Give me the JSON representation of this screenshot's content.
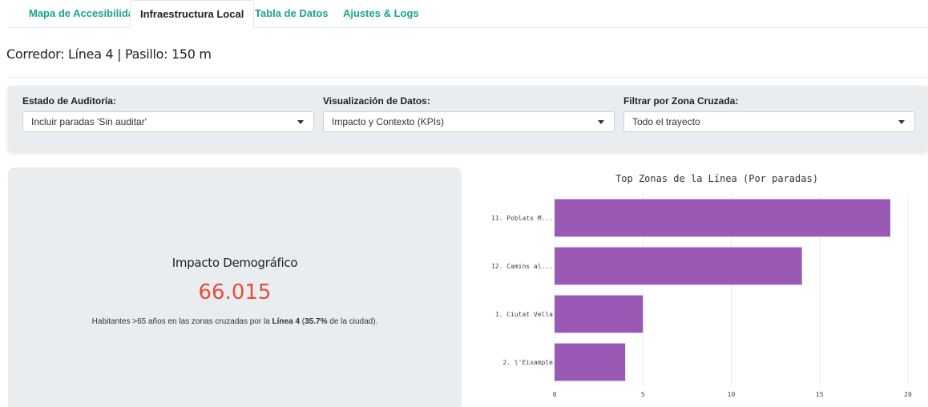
{
  "tabs": [
    {
      "label": "Mapa de Accesibilidad",
      "active": false
    },
    {
      "label": "Infraestructura Local",
      "active": true
    },
    {
      "label": "Tabla de Datos",
      "active": false
    },
    {
      "label": "Ajustes & Logs",
      "active": false
    }
  ],
  "header": {
    "title": "Corredor: Línea 4 | Pasillo: 150 m"
  },
  "filters": {
    "audit": {
      "label": "Estado de Auditoría:",
      "value": "Incluir paradas 'Sin auditar'"
    },
    "viz": {
      "label": "Visualización de Datos:",
      "value": "Impacto y Contexto (KPIs)"
    },
    "zone": {
      "label": "Filtrar por Zona Cruzada:",
      "value": "Todo el trayecto"
    }
  },
  "kpi": {
    "title": "Impacto Demográfico",
    "value": "66.015",
    "desc_prefix": "Habitantes >65 años en las zonas cruzadas por la ",
    "desc_line": "Línea 4",
    "desc_mid": " (",
    "desc_pct": "35.7%",
    "desc_suffix": " de la ciudad).",
    "value_color": "#e74c3c"
  },
  "chart_data": {
    "type": "bar",
    "orientation": "horizontal",
    "title": "Top Zonas de la Línea (Por paradas)",
    "categories": [
      "11. Poblats M...",
      "12. Camins al...",
      "1. Ciutat Vella",
      "2. l'Eixample"
    ],
    "values": [
      19,
      14,
      5,
      4
    ],
    "xlim": [
      0,
      20
    ],
    "xticks": [
      0,
      5,
      10,
      15,
      20
    ],
    "bar_color": "#9b59b6",
    "grid": true
  }
}
